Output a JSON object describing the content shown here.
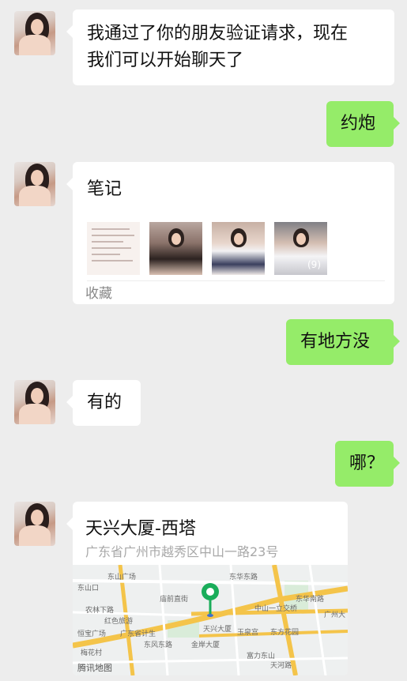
{
  "messages": {
    "m1_text": "我通过了你的朋友验证请求，现在我们可以开始聊天了",
    "m1_line1": "我通过了你的朋友验证请求，现在",
    "m1_line2": "我们可以开始聊天了",
    "m2_text": "约炮",
    "m3_note_title": "笔记",
    "m3_thumb_count": "(9)",
    "m3_fav_label": "收藏",
    "m4_text": "有地方没",
    "m5_text": "有的",
    "m6_text": "哪？",
    "m7_location_title": "天兴大厦-西塔",
    "m7_location_address": "广东省广州市越秀区中山一路23号"
  },
  "map": {
    "brand": "腾讯地图",
    "labels": {
      "l1": "东山广场",
      "l2": "东山口",
      "l3": "农林下路",
      "l4": "中山一立交桥",
      "l5": "东华东路",
      "l6": "天兴大厦",
      "l7": "玉泉宫",
      "l8": "东方花园",
      "l9": "东华南路",
      "l10": "恒宝广场",
      "l11": "梅花村",
      "l12": "天河路",
      "l13": "庙前直街",
      "l14": "红色旅游",
      "l15": "广东省计生",
      "l16": "东风东路",
      "l17": "广州大",
      "l18": "金岸大厦",
      "l19": "富力东山"
    },
    "colors": {
      "main_road": "#f4c44a",
      "green": "#1aad5a"
    }
  },
  "colors": {
    "sent_bubble": "#95ec69",
    "received_bubble": "#ffffff",
    "background": "#ededed"
  }
}
